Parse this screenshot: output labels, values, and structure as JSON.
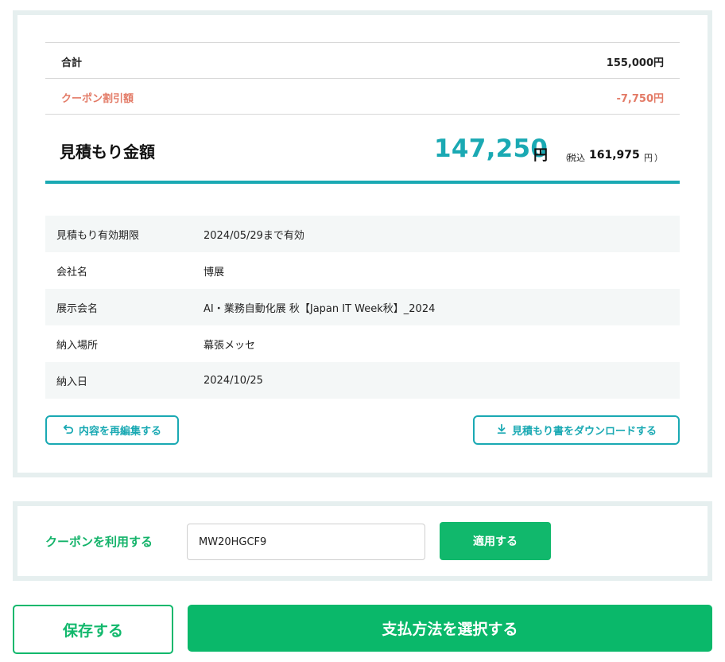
{
  "summary": {
    "subtotal_label": "合計",
    "subtotal_value": "155,000円",
    "coupon_discount_label": "クーポン割引額",
    "coupon_discount_value": "-7,750円",
    "total_label": "見積もり金額",
    "total_amount": "147,250",
    "total_yen": "円",
    "tax_paren_open": "（",
    "tax_label": "税込",
    "tax_amount": "161,975",
    "tax_yen": "円",
    "tax_paren_close": "）"
  },
  "details": [
    {
      "key": "見積もり有効期限",
      "value": "2024/05/29まで有効"
    },
    {
      "key": "会社名",
      "value": "博展"
    },
    {
      "key": "展示会名",
      "value": "AI・業務自動化展 秋【Japan IT Week秋】_2024"
    },
    {
      "key": "納入場所",
      "value": "幕張メッセ"
    },
    {
      "key": "納入日",
      "value": "2024/10/25"
    }
  ],
  "actions": {
    "reedit_label": "内容を再編集する",
    "download_label": "見積もり書をダウンロードする"
  },
  "coupon": {
    "label": "クーポンを利用する",
    "code": "MW20HGCF9",
    "apply_label": "適用する"
  },
  "footer": {
    "save_label": "保存する",
    "pay_label": "支払方法を選択する"
  },
  "colors": {
    "accent_teal": "#1aa9b3",
    "primary_green": "#11b86c",
    "discount_red": "#e37b67"
  },
  "icons": {
    "reedit": "undo-arrow-icon",
    "download": "download-icon"
  }
}
